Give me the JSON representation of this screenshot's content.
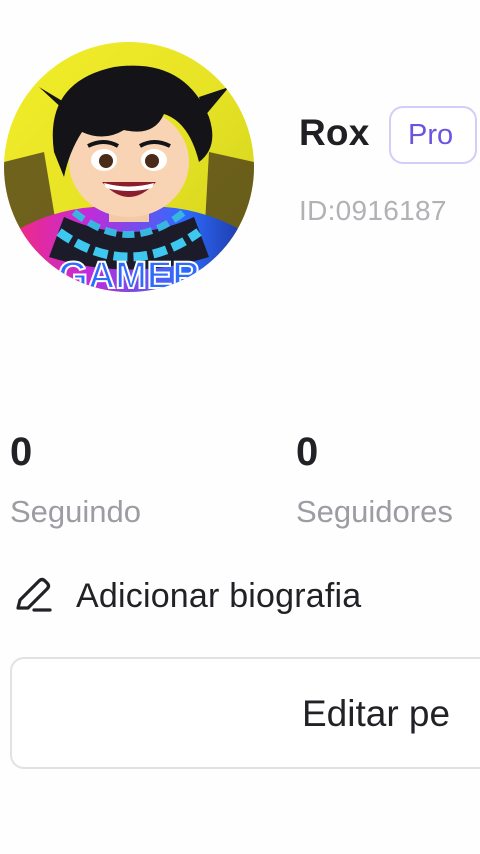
{
  "profile": {
    "name": "Rox",
    "badge": "Pro",
    "id_text": "ID:0916187",
    "avatar_icon": "avatar-gamer-boy"
  },
  "stats": [
    {
      "value": "0",
      "label": "Seguindo"
    },
    {
      "value": "0",
      "label": "Seguidores"
    }
  ],
  "bio": {
    "icon": "pencil-icon",
    "label": "Adicionar biografia"
  },
  "actions": {
    "edit_label": "Editar pe"
  },
  "colors": {
    "badge_text": "#6a55e0",
    "badge_border": "#d6ccf7",
    "muted_text": "#9c9ca2"
  }
}
